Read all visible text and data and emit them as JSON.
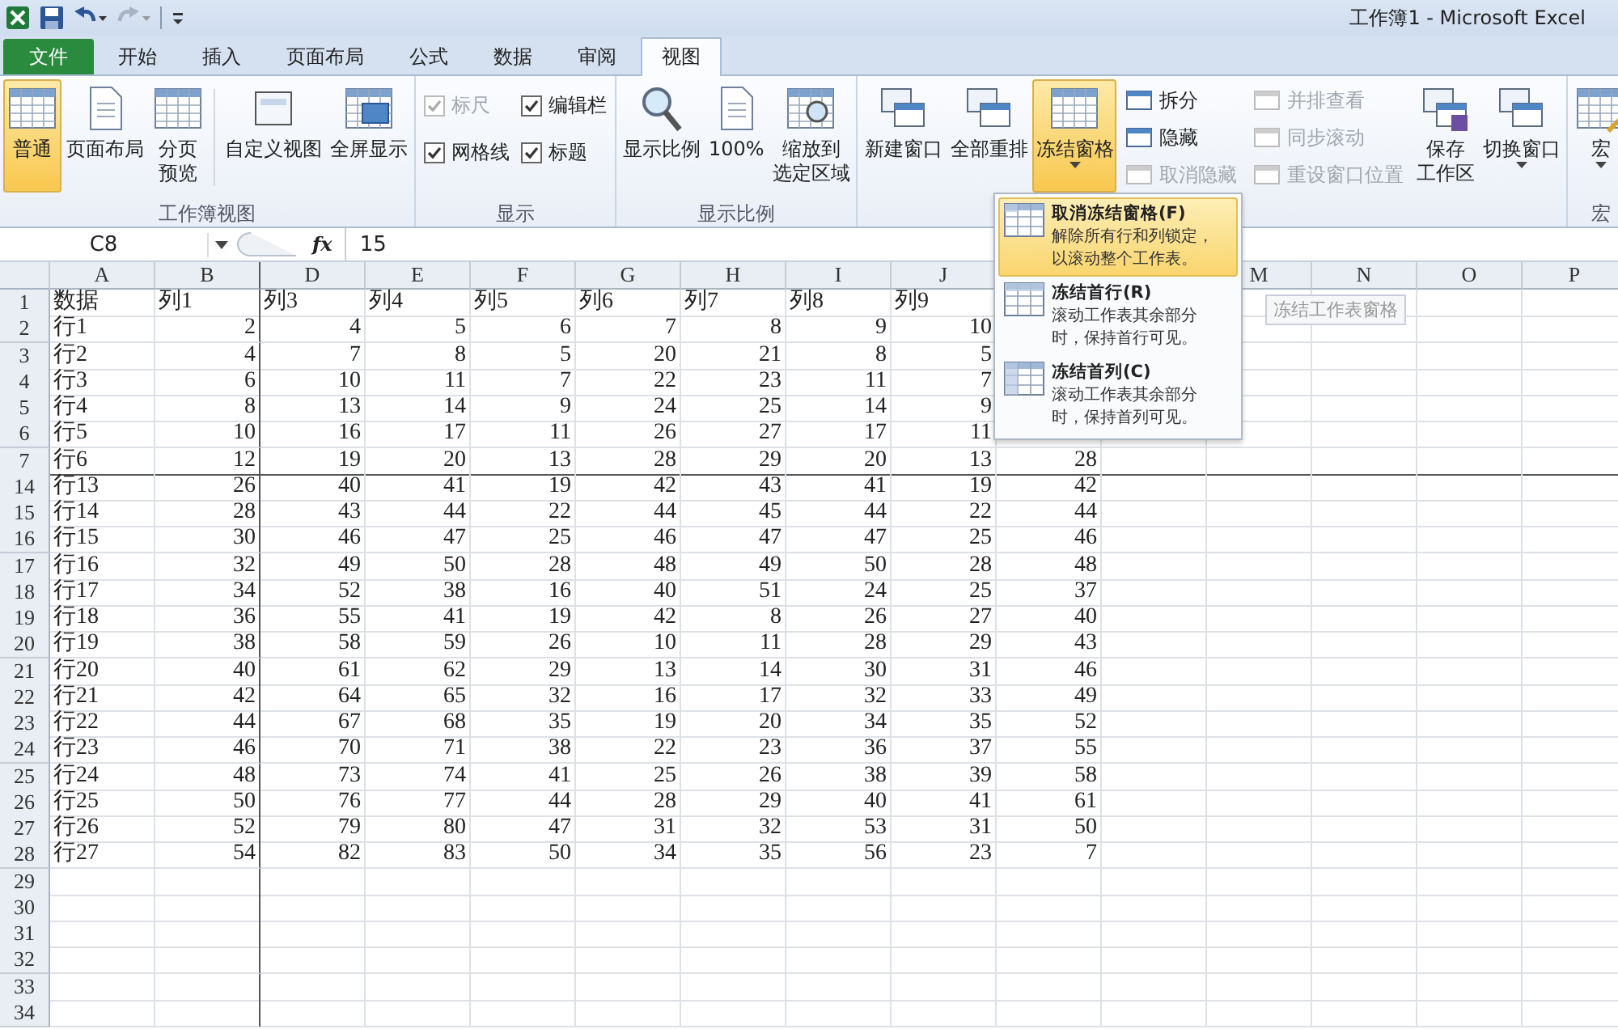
{
  "title": "工作簿1 - Microsoft Excel",
  "tabs": [
    {
      "label": "文件",
      "kind": "file",
      "selected": false
    },
    {
      "label": "开始",
      "kind": "tab",
      "selected": false
    },
    {
      "label": "插入",
      "kind": "tab",
      "selected": false
    },
    {
      "label": "页面布局",
      "kind": "tab",
      "selected": false
    },
    {
      "label": "公式",
      "kind": "tab",
      "selected": false
    },
    {
      "label": "数据",
      "kind": "tab",
      "selected": false
    },
    {
      "label": "审阅",
      "kind": "tab",
      "selected": false
    },
    {
      "label": "视图",
      "kind": "tab",
      "selected": true
    }
  ],
  "ribbon": {
    "groups": [
      {
        "label": "工作簿视图",
        "items": [
          {
            "kind": "large",
            "label": "普通",
            "selected": true,
            "dropdown": false
          },
          {
            "kind": "large",
            "label": "页面布局",
            "selected": false,
            "dropdown": false
          },
          {
            "kind": "large",
            "lines": [
              "分页",
              "预览"
            ],
            "selected": false,
            "dropdown": false
          },
          {
            "kind": "separator"
          },
          {
            "kind": "large",
            "label": "自定义视图",
            "selected": false,
            "dropdown": false
          },
          {
            "kind": "large",
            "label": "全屏显示",
            "selected": false,
            "dropdown": false
          }
        ]
      },
      {
        "label": "显示",
        "items": [
          {
            "kind": "stack",
            "items": [
              {
                "kind": "check",
                "label": "标尺",
                "checked": true,
                "disabled": true
              },
              {
                "kind": "check",
                "label": "网格线",
                "checked": true,
                "disabled": false
              }
            ]
          },
          {
            "kind": "stack",
            "items": [
              {
                "kind": "check",
                "label": "编辑栏",
                "checked": true,
                "disabled": false
              },
              {
                "kind": "check",
                "label": "标题",
                "checked": true,
                "disabled": false
              }
            ]
          }
        ]
      },
      {
        "label": "显示比例",
        "items": [
          {
            "kind": "large",
            "label": "显示比例",
            "selected": false,
            "dropdown": false
          },
          {
            "kind": "large",
            "label": "100%",
            "selected": false,
            "dropdown": false
          },
          {
            "kind": "large",
            "lines": [
              "缩放到",
              "选定区域"
            ],
            "selected": false,
            "dropdown": false
          }
        ]
      },
      {
        "items": [
          {
            "kind": "large",
            "label": "新建窗口",
            "selected": false,
            "dropdown": false
          },
          {
            "kind": "large",
            "label": "全部重排",
            "selected": false,
            "dropdown": false
          },
          {
            "kind": "large",
            "label": "冻结窗格",
            "selected": true,
            "dropdown": true
          },
          {
            "kind": "stack",
            "items": [
              {
                "kind": "small",
                "label": "拆分",
                "disabled": false
              },
              {
                "kind": "small",
                "label": "隐藏",
                "disabled": false
              },
              {
                "kind": "small",
                "label": "取消隐藏",
                "disabled": true
              }
            ]
          },
          {
            "kind": "stack",
            "items": [
              {
                "kind": "small",
                "label": "并排查看",
                "disabled": true
              },
              {
                "kind": "small",
                "label": "同步滚动",
                "disabled": true
              },
              {
                "kind": "small",
                "label": "重设窗口位置",
                "disabled": true
              }
            ]
          },
          {
            "kind": "large",
            "lines": [
              "保存",
              "工作区"
            ],
            "selected": false,
            "dropdown": false
          },
          {
            "kind": "large",
            "label": "切换窗口",
            "selected": false,
            "dropdown": true
          }
        ]
      },
      {
        "label": "宏",
        "items": [
          {
            "kind": "large",
            "label": "宏",
            "selected": false,
            "dropdown": true
          }
        ]
      }
    ]
  },
  "formula_bar": {
    "name_box": "C8",
    "fx": "fx",
    "value": "15"
  },
  "sheet": {
    "columns": [
      "A",
      "B",
      "D",
      "E",
      "F",
      "G",
      "H",
      "I",
      "J"
    ],
    "columns_right": [
      "M",
      "N",
      "O",
      "P"
    ],
    "rows": [
      {
        "header": "1",
        "cells": [
          "数据",
          "列1",
          "列3",
          "列4",
          "列5",
          "列6",
          "列7",
          "列8",
          "列9"
        ]
      },
      {
        "header": "2",
        "cells": [
          "行1",
          "2",
          "4",
          "5",
          "6",
          "7",
          "8",
          "9",
          "10"
        ]
      },
      {
        "header": "3",
        "cells": [
          "行2",
          "4",
          "7",
          "8",
          "5",
          "20",
          "21",
          "8",
          "5"
        ]
      },
      {
        "header": "4",
        "cells": [
          "行3",
          "6",
          "10",
          "11",
          "7",
          "22",
          "23",
          "11",
          "7"
        ]
      },
      {
        "header": "5",
        "cells": [
          "行4",
          "8",
          "13",
          "14",
          "9",
          "24",
          "25",
          "14",
          "9"
        ]
      },
      {
        "header": "6",
        "cells": [
          "行5",
          "10",
          "16",
          "17",
          "11",
          "26",
          "27",
          "17",
          "11"
        ]
      },
      {
        "header": "7",
        "cells": [
          "行6",
          "12",
          "19",
          "20",
          "13",
          "28",
          "29",
          "20",
          "13",
          "28"
        ]
      },
      {
        "header": "14",
        "cells": [
          "行13",
          "26",
          "40",
          "41",
          "19",
          "42",
          "43",
          "41",
          "19",
          "42"
        ]
      },
      {
        "header": "15",
        "cells": [
          "行14",
          "28",
          "43",
          "44",
          "22",
          "44",
          "45",
          "44",
          "22",
          "44"
        ]
      },
      {
        "header": "16",
        "cells": [
          "行15",
          "30",
          "46",
          "47",
          "25",
          "46",
          "47",
          "47",
          "25",
          "46"
        ]
      },
      {
        "header": "17",
        "cells": [
          "行16",
          "32",
          "49",
          "50",
          "28",
          "48",
          "49",
          "50",
          "28",
          "48"
        ]
      },
      {
        "header": "18",
        "cells": [
          "行17",
          "34",
          "52",
          "38",
          "16",
          "40",
          "51",
          "24",
          "25",
          "37"
        ]
      },
      {
        "header": "19",
        "cells": [
          "行18",
          "36",
          "55",
          "41",
          "19",
          "42",
          "8",
          "26",
          "27",
          "40"
        ]
      },
      {
        "header": "20",
        "cells": [
          "行19",
          "38",
          "58",
          "59",
          "26",
          "10",
          "11",
          "28",
          "29",
          "43"
        ]
      },
      {
        "header": "21",
        "cells": [
          "行20",
          "40",
          "61",
          "62",
          "29",
          "13",
          "14",
          "30",
          "31",
          "46"
        ]
      },
      {
        "header": "22",
        "cells": [
          "行21",
          "42",
          "64",
          "65",
          "32",
          "16",
          "17",
          "32",
          "33",
          "49"
        ]
      },
      {
        "header": "23",
        "cells": [
          "行22",
          "44",
          "67",
          "68",
          "35",
          "19",
          "20",
          "34",
          "35",
          "52"
        ]
      },
      {
        "header": "24",
        "cells": [
          "行23",
          "46",
          "70",
          "71",
          "38",
          "22",
          "23",
          "36",
          "37",
          "55"
        ]
      },
      {
        "header": "25",
        "cells": [
          "行24",
          "48",
          "73",
          "74",
          "41",
          "25",
          "26",
          "38",
          "39",
          "58"
        ]
      },
      {
        "header": "26",
        "cells": [
          "行25",
          "50",
          "76",
          "77",
          "44",
          "28",
          "29",
          "40",
          "41",
          "61"
        ]
      },
      {
        "header": "27",
        "cells": [
          "行26",
          "52",
          "79",
          "80",
          "47",
          "31",
          "32",
          "53",
          "31",
          "50"
        ]
      },
      {
        "header": "28",
        "cells": [
          "行27",
          "54",
          "82",
          "83",
          "50",
          "34",
          "35",
          "56",
          "23",
          "7"
        ]
      },
      {
        "header": "29"
      },
      {
        "header": "30"
      },
      {
        "header": "31"
      },
      {
        "header": "32"
      },
      {
        "header": "33"
      },
      {
        "header": "34"
      }
    ]
  },
  "freeze_menu": {
    "items": [
      {
        "title": "取消冻结窗格(F)",
        "description_lines": [
          "解除所有行和列锁定，",
          "以滚动整个工作表。"
        ],
        "selected": true
      },
      {
        "title": "冻结首行(R)",
        "description_lines": [
          "滚动工作表其余部分",
          "时，保持首行可见。"
        ],
        "selected": false
      },
      {
        "title": "冻结首列(C)",
        "description_lines": [
          "滚动工作表其余部分",
          "时，保持首列可见。"
        ],
        "selected": false
      }
    ]
  },
  "tooltip": "冻结工作表窗格"
}
